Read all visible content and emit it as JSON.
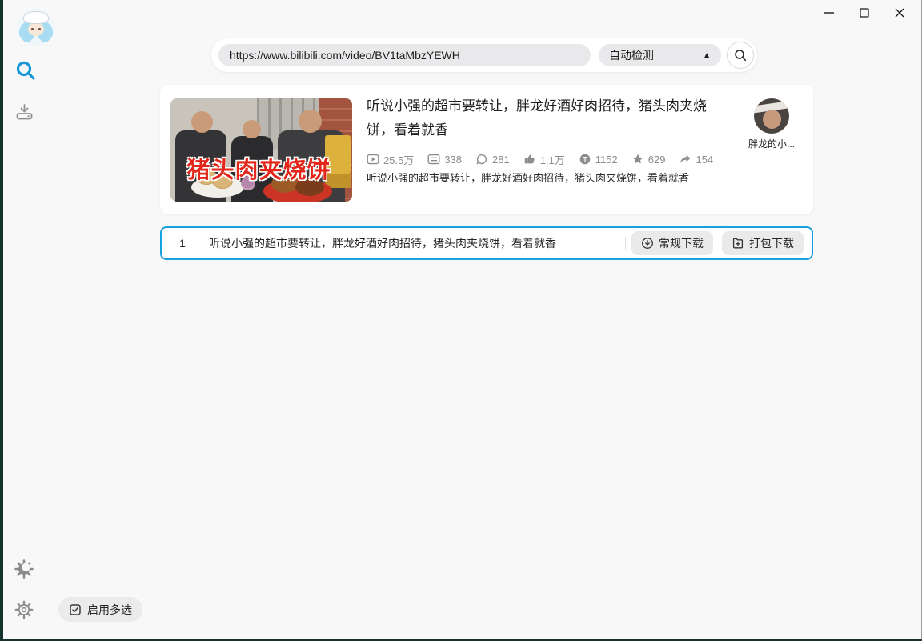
{
  "window": {
    "controls": {
      "minimize": "minimize",
      "maximize": "maximize",
      "close": "close"
    }
  },
  "colors": {
    "accent_border_blue": "#18a2dd",
    "sidebar_search_blue": "#1698d8",
    "window_edge_dark_teal": "#14332c",
    "thumbnail_caption_red": "#e3261a",
    "pill_gray": "#e9e9eb"
  },
  "sidebar": {
    "icons": [
      "search",
      "download",
      "theme-toggle",
      "settings"
    ],
    "multi_select_label": "启用多选"
  },
  "search": {
    "url": "https://www.bilibili.com/video/BV1taMbzYEWH",
    "detect_label": "自动检测",
    "detect_arrow": "▲"
  },
  "video_card": {
    "title": "听说小强的超市要转让，胖龙好酒好肉招待，猪头肉夹烧饼，看着就香",
    "description": "听说小强的超市要转让，胖龙好酒好肉招待，猪头肉夹烧饼，看着就香",
    "thumbnail_caption": "猪头肉夹烧饼",
    "uploader_name": "胖龙的小...",
    "stats": [
      {
        "name": "play",
        "value": "25.5万"
      },
      {
        "name": "danmaku",
        "value": "338"
      },
      {
        "name": "comment",
        "value": "281"
      },
      {
        "name": "like",
        "value": "1.1万"
      },
      {
        "name": "coin",
        "value": "1152"
      },
      {
        "name": "favorite",
        "value": "629"
      },
      {
        "name": "share",
        "value": "154"
      }
    ]
  },
  "download_row": {
    "index": "1",
    "title": "听说小强的超市要转让，胖龙好酒好肉招待，猪头肉夹烧饼，看着就香",
    "buttons": [
      {
        "icon": "download-circle-icon",
        "label": "常规下载"
      },
      {
        "icon": "box-plus-icon",
        "label": "打包下载"
      }
    ]
  }
}
